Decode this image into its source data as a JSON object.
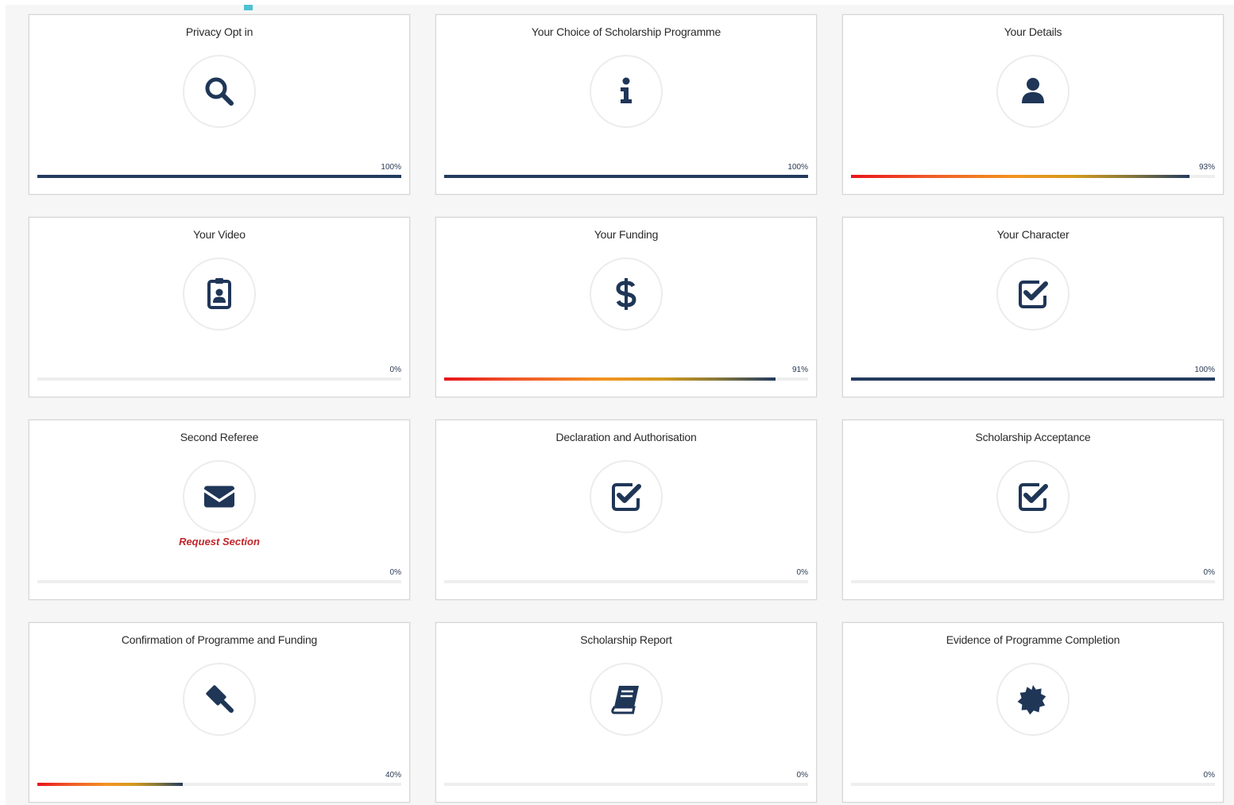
{
  "colors": {
    "accent": "#4ec1cf",
    "icon": "#1f3657",
    "progress_complete": "#233b5e",
    "progress_gradient": [
      "#e8141b",
      "#f39420",
      "#233b5e"
    ],
    "request_link": "#c0262b"
  },
  "sections": [
    {
      "title": "Privacy Opt in",
      "icon": "search-icon",
      "percent_label": "100%",
      "progress": 1.0
    },
    {
      "title": "Your Choice of Scholarship Programme",
      "icon": "info-icon",
      "percent_label": "100%",
      "progress": 1.0
    },
    {
      "title": "Your Details",
      "icon": "user-icon",
      "percent_label": "93%",
      "progress": 0.93
    },
    {
      "title": "Your Video",
      "icon": "id-badge-icon",
      "percent_label": "0%",
      "progress": 0.0
    },
    {
      "title": "Your Funding",
      "icon": "dollar-icon",
      "percent_label": "91%",
      "progress": 0.91
    },
    {
      "title": "Your Character",
      "icon": "checkbox-icon",
      "percent_label": "100%",
      "progress": 1.0
    },
    {
      "title": "Second Referee",
      "icon": "envelope-icon",
      "percent_label": "0%",
      "progress": 0.0,
      "link": "Request Section"
    },
    {
      "title": "Declaration and Authorisation",
      "icon": "checkbox-icon",
      "percent_label": "0%",
      "progress": 0.0
    },
    {
      "title": "Scholarship Acceptance",
      "icon": "checkbox-icon",
      "percent_label": "0%",
      "progress": 0.0
    },
    {
      "title": "Confirmation of Programme and Funding",
      "icon": "gavel-icon",
      "percent_label": "40%",
      "progress": 0.4
    },
    {
      "title": "Scholarship Report",
      "icon": "book-icon",
      "percent_label": "0%",
      "progress": 0.0
    },
    {
      "title": "Evidence of Programme Completion",
      "icon": "certificate-icon",
      "percent_label": "0%",
      "progress": 0.0
    }
  ]
}
